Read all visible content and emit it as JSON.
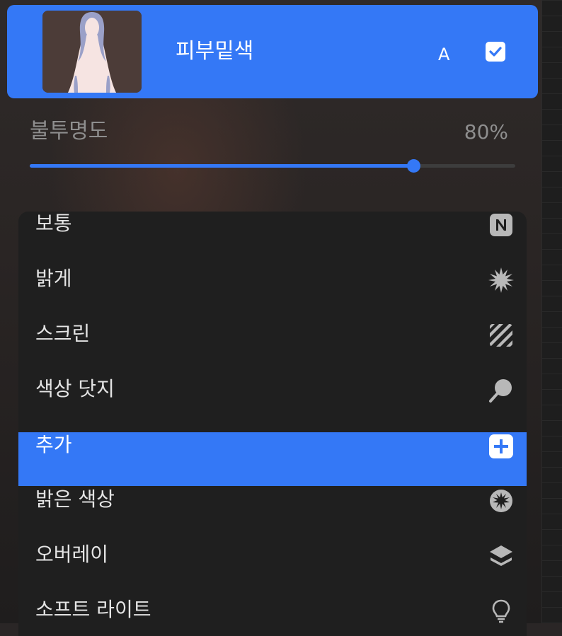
{
  "layer": {
    "name": "피부밑색",
    "blend_mode_letter": "A",
    "visible": true
  },
  "opacity": {
    "label": "불투명도",
    "value_text": "80%",
    "value": 0.79
  },
  "blend_modes": [
    {
      "label": "보통",
      "icon": "normal-n-icon"
    },
    {
      "label": "밝게",
      "icon": "lighten-starburst-icon"
    },
    {
      "label": "스크린",
      "icon": "screen-stripes-icon"
    },
    {
      "label": "색상 닷지",
      "icon": "color-dodge-magnifier-icon"
    },
    {
      "label": "추가",
      "icon": "add-plus-icon",
      "selected": true
    },
    {
      "label": "밝은 색상",
      "icon": "lighter-color-icon"
    },
    {
      "label": "오버레이",
      "icon": "overlay-layers-icon"
    },
    {
      "label": "소프트 라이트",
      "icon": "soft-light-bulb-icon"
    }
  ],
  "colors": {
    "accent": "#3478f6",
    "panel": "#1f1f1f",
    "icon_gray": "#b8b8b8"
  }
}
